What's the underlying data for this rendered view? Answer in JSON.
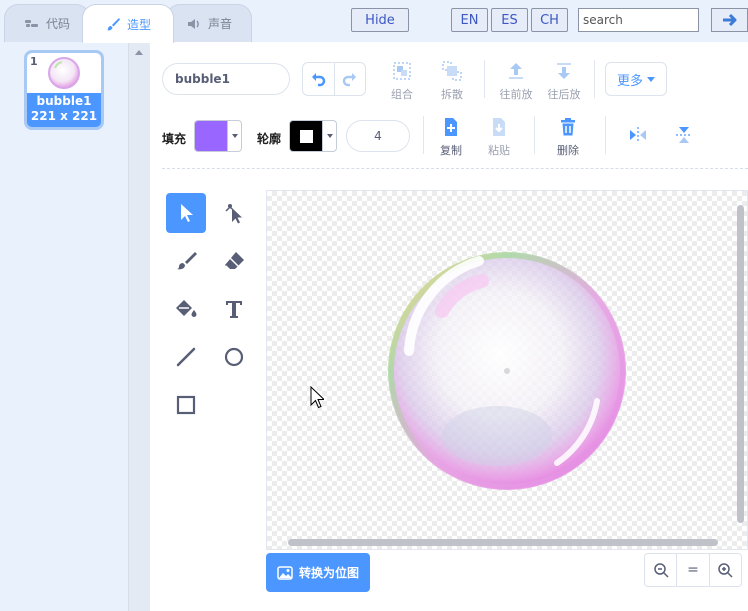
{
  "tabs": [
    {
      "label": "代码",
      "icon": "code-icon"
    },
    {
      "label": "造型",
      "icon": "paintbrush-icon",
      "active": true
    },
    {
      "label": "声音",
      "icon": "speaker-icon"
    }
  ],
  "topbar": {
    "hide_label": "Hide",
    "lang": [
      "EN",
      "ES",
      "CH"
    ],
    "search_placeholder": "search",
    "go_icon": "arrow-right-icon"
  },
  "costume": {
    "number": "1",
    "name": "bubble1",
    "size": "221 x 221"
  },
  "toolbar": {
    "costume_name": "bubble1",
    "group_label": "组合",
    "ungroup_label": "拆散",
    "forward_label": "往前放",
    "backward_label": "往后放",
    "more_label": "更多",
    "fill_label": "填充",
    "outline_label": "轮廓",
    "outline_width": "4",
    "copy_label": "复制",
    "paste_label": "粘贴",
    "delete_label": "删除"
  },
  "colors": {
    "fill": "#9966ff",
    "outline": "#000000",
    "accent": "#4c97ff"
  },
  "tools": [
    "select-icon",
    "reshape-icon",
    "brush-icon",
    "eraser-icon",
    "fill-icon",
    "text-icon",
    "line-icon",
    "circle-icon",
    "rectangle-icon"
  ],
  "bottom": {
    "bitmap_label": "转换为位图",
    "zoom_reset": "="
  }
}
